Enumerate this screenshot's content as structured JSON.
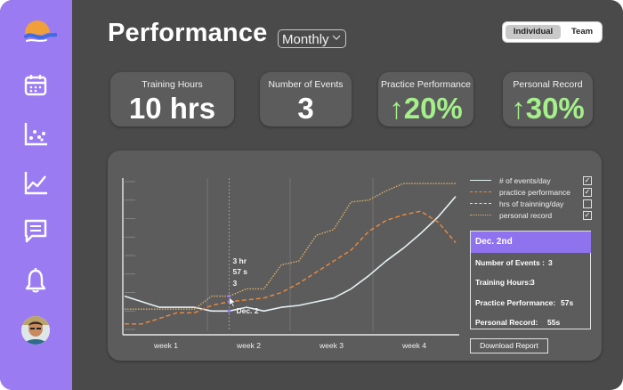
{
  "header": {
    "title": "Performance",
    "period": "Monthly",
    "toggle": [
      "Individual",
      "Team"
    ],
    "toggle_selected": "Individual"
  },
  "sidebar": {
    "items": [
      {
        "name": "logo",
        "icon": "logo-icon"
      },
      {
        "name": "calendar",
        "icon": "calendar-icon"
      },
      {
        "name": "scatter",
        "icon": "scatter-chart-icon"
      },
      {
        "name": "trend",
        "icon": "line-chart-icon"
      },
      {
        "name": "messages",
        "icon": "message-icon"
      },
      {
        "name": "notifications",
        "icon": "bell-icon"
      },
      {
        "name": "profile",
        "icon": "avatar"
      }
    ],
    "accent": "#9b7bf2"
  },
  "stats": [
    {
      "label": "Training Hours",
      "value": "10 hrs"
    },
    {
      "label": "Number of Events",
      "value": "3"
    },
    {
      "label": "Practice Performance",
      "value": "↑20%"
    },
    {
      "label": "Personal Record",
      "value": "↑30%"
    }
  ],
  "legend": [
    {
      "label": "# of events/day",
      "checked": true
    },
    {
      "label": "practice performance",
      "checked": true
    },
    {
      "label": "hrs of trainning/day",
      "checked": false
    },
    {
      "label": "personal record",
      "checked": true
    }
  ],
  "details": {
    "date": "Dec. 2nd",
    "rows": [
      {
        "label": "Number of Events :",
        "value": "3"
      },
      {
        "label": "Training Hours:",
        "value": "3"
      },
      {
        "label": "Practice Performance:",
        "value": "57s"
      },
      {
        "label": "Personal Record:",
        "value": "55s"
      }
    ]
  },
  "download_label": "Download Report",
  "tooltip": {
    "hours": "3 hr",
    "seconds": "57 s",
    "events": "3",
    "date": "Dec. 2"
  },
  "chart_data": {
    "type": "line",
    "categories": [
      "week 1",
      "week 2",
      "week 3",
      "week 4"
    ],
    "x": [
      0,
      1,
      2,
      3,
      4,
      5,
      6,
      7,
      8,
      9,
      10,
      11,
      12,
      13,
      14,
      15,
      16,
      17,
      18,
      19
    ],
    "series": [
      {
        "name": "# of events/day",
        "color": "#e6f1f3",
        "style": "solid",
        "values": [
          1.8,
          1.5,
          1.2,
          1.2,
          1.2,
          1.0,
          1.0,
          1.2,
          1.0,
          1.2,
          1.3,
          1.5,
          1.7,
          2.2,
          2.9,
          3.7,
          4.4,
          5.2,
          6.1,
          7.2
        ]
      },
      {
        "name": "practice performance",
        "color": "#f08a3c",
        "style": "dashed",
        "values": [
          0.3,
          0.3,
          0.6,
          0.9,
          0.9,
          1.3,
          1.5,
          1.6,
          1.7,
          2.0,
          2.5,
          3.1,
          3.7,
          4.3,
          5.3,
          5.9,
          6.2,
          6.4,
          5.8,
          4.7
        ]
      },
      {
        "name": "personal record",
        "color": "#d9b06a",
        "style": "dotted",
        "values": [
          1.1,
          1.1,
          1.1,
          1.1,
          1.1,
          1.8,
          1.8,
          2.2,
          2.2,
          3.5,
          3.7,
          5.1,
          5.4,
          6.9,
          7.0,
          7.5,
          7.9,
          7.9,
          7.9,
          7.9
        ]
      }
    ],
    "highlight_index": 6,
    "ylim": [
      0,
      8
    ],
    "grid": true,
    "legend_position": "right"
  }
}
